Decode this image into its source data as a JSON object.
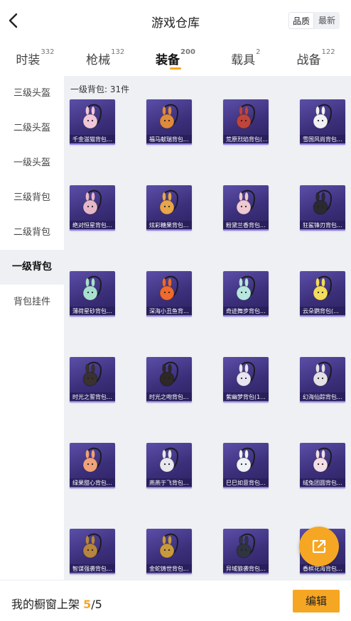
{
  "header": {
    "title": "游戏仓库",
    "toggle": [
      "品质",
      "最新"
    ]
  },
  "tabs": [
    {
      "label": "时装",
      "count": "332"
    },
    {
      "label": "枪械",
      "count": "132"
    },
    {
      "label": "装备",
      "count": "200"
    },
    {
      "label": "载具",
      "count": "2"
    },
    {
      "label": "战备",
      "count": "122"
    }
  ],
  "sidebar": [
    "三级头盔",
    "二级头盔",
    "一级头盔",
    "三级背包",
    "二级背包",
    "一级背包",
    "背包挂件"
  ],
  "section_title": "一级背包: 31件",
  "items": [
    {
      "label": "千金滋猫背包...",
      "icon": "cat-backpack-icon",
      "color": "#f2c6d8"
    },
    {
      "label": "福马献瑞背包...",
      "icon": "horse-backpack-icon",
      "color": "#e08a3c"
    },
    {
      "label": "荒原烈焰背包(...",
      "icon": "rabbit-backpack-icon",
      "color": "#c0443a"
    },
    {
      "label": "雪国风尚背包...",
      "icon": "snow-backpack-icon",
      "color": "#f2f2f6"
    },
    {
      "label": "绝对恒星背包...",
      "icon": "cup-backpack-icon",
      "color": "#e6b7c9"
    },
    {
      "label": "炫彩糖果背包...",
      "icon": "donut-backpack-icon",
      "color": "#e7a64a"
    },
    {
      "label": "粉黛兰香背包...",
      "icon": "bunny-backpack-icon",
      "color": "#f0c8d2"
    },
    {
      "label": "狂鲨锋刃背包...",
      "icon": "shark-backpack-icon",
      "color": "#2a2a30"
    },
    {
      "label": "薄荷星砂背包...",
      "icon": "mint-backpack-icon",
      "color": "#a8e0cf"
    },
    {
      "label": "深海小丑鱼背...",
      "icon": "clownfish-backpack-icon",
      "color": "#ef6a2c"
    },
    {
      "label": "奇迹舞步背包...",
      "icon": "dance-backpack-icon",
      "color": "#b7e6df"
    },
    {
      "label": "云朵鹦背包(...",
      "icon": "cloud-backpack-icon",
      "color": "#f3dc5a"
    },
    {
      "label": "时光之誓背包...",
      "icon": "clock-backpack-icon",
      "color": "#3a3130"
    },
    {
      "label": "时光之吻背包...",
      "icon": "clock-backpack-icon",
      "color": "#2e2826"
    },
    {
      "label": "紫幽梦背包(1...",
      "icon": "purple-bunny-backpack-icon",
      "color": "#e9e4f2"
    },
    {
      "label": "幻海仙踪背包...",
      "icon": "shell-backpack-icon",
      "color": "#e3e0e6"
    },
    {
      "label": "绿果甜心背包...",
      "icon": "fruit-backpack-icon",
      "color": "#f0a27a"
    },
    {
      "label": "燕燕于飞背包...",
      "icon": "swallow-backpack-icon",
      "color": "#e8e8ee"
    },
    {
      "label": "巳巳如意背包...",
      "icon": "snake-backpack-icon",
      "color": "#eef2f6"
    },
    {
      "label": "绒兔团圆背包...",
      "icon": "plush-bunny-backpack-icon",
      "color": "#f3dfe6"
    },
    {
      "label": "智谋强袭背包...",
      "icon": "fox-backpack-icon",
      "color": "#b7853f"
    },
    {
      "label": "金蛇铸世背包...",
      "icon": "golden-snake-backpack-icon",
      "color": "#c89a3e"
    },
    {
      "label": "异域狼袭背包...",
      "icon": "wolf-backpack-icon",
      "color": "#2f3440"
    },
    {
      "label": "香槟花海背包...",
      "icon": "flower-backpack-icon",
      "color": "#e8d7b0"
    }
  ],
  "bottom": {
    "shelf_label": "我的橱窗上架",
    "current": "5",
    "total": "/5",
    "edit": "编辑"
  }
}
